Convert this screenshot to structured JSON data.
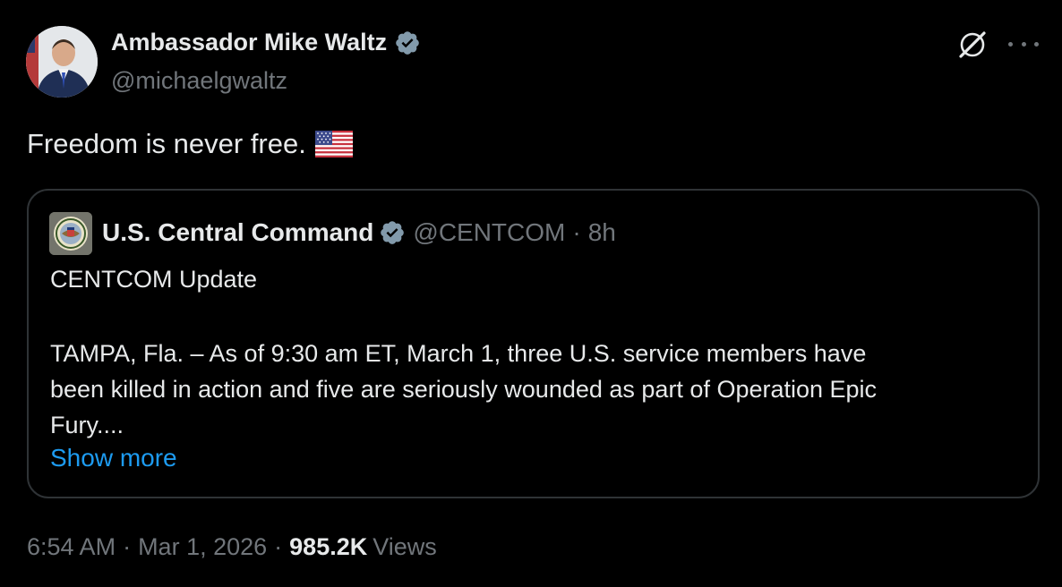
{
  "author": {
    "name": "Ambassador Mike Waltz",
    "handle": "@michaelgwaltz",
    "verified_color": "#829aab"
  },
  "tweet": {
    "text": "Freedom is never free.",
    "emoji": "us-flag"
  },
  "quoted_tweet": {
    "name": "U.S. Central Command",
    "handle": "@CENTCOM",
    "separator": "·",
    "time": "8h",
    "title": "CENTCOM Update",
    "body_lines": [
      "TAMPA, Fla. – As of 9:30 am ET, March 1, three U.S. service members have",
      "been killed in action and five are seriously wounded as part of Operation Epic",
      "Fury...."
    ],
    "show_more": "Show more"
  },
  "meta": {
    "time": "6:54 AM",
    "separator": "·",
    "date": "Mar 1, 2026",
    "separator2": "·",
    "views_count": "985.2K",
    "views_label": "Views"
  },
  "icons": {
    "grok": "grok-icon",
    "more": "more-icon"
  },
  "colors": {
    "background": "#000000",
    "text": "#e7e9ea",
    "secondary": "#71767b",
    "link": "#1d9bf0",
    "border": "#2f3336"
  }
}
